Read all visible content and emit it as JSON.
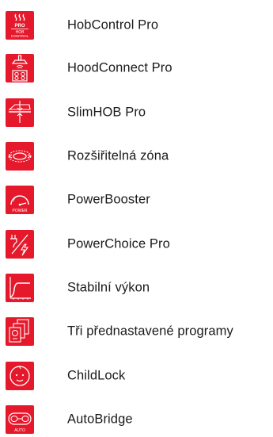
{
  "accent_color": "#e5192b",
  "features": [
    {
      "icon": "hob-control-pro-icon",
      "icon_text": "PRO HOB CONTROL",
      "label": "HobControl Pro"
    },
    {
      "icon": "hood-connect-icon",
      "label": "HoodConnect Pro"
    },
    {
      "icon": "slim-hob-icon",
      "label": "SlimHOB Pro"
    },
    {
      "icon": "extendable-zone-icon",
      "label": "Rozšiřitelná zóna"
    },
    {
      "icon": "power-booster-icon",
      "icon_text": "POWER",
      "label": "PowerBooster"
    },
    {
      "icon": "power-choice-icon",
      "label": "PowerChoice Pro"
    },
    {
      "icon": "stable-power-icon",
      "label": "Stabilní výkon"
    },
    {
      "icon": "preset-programs-icon",
      "label": "Tři přednastavené programy"
    },
    {
      "icon": "child-lock-icon",
      "label": "ChildLock"
    },
    {
      "icon": "auto-bridge-icon",
      "icon_text": "AUTO",
      "label": "AutoBridge"
    }
  ]
}
